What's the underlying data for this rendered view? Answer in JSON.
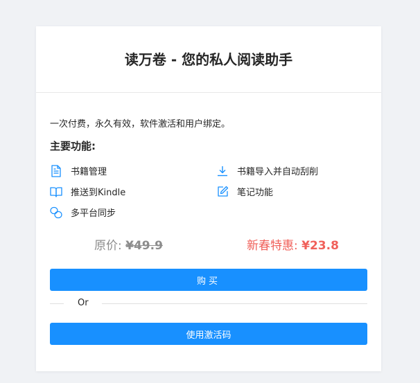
{
  "header": {
    "title": "读万卷 - 您的私人阅读助手"
  },
  "description": "一次付费，永久有效，软件激活和用户绑定。",
  "features": {
    "title": "主要功能:",
    "items": [
      {
        "label": "书籍管理",
        "icon": "document-icon"
      },
      {
        "label": "书籍导入并自动刮削",
        "icon": "download-icon"
      },
      {
        "label": "推送到Kindle",
        "icon": "book-icon"
      },
      {
        "label": "笔记功能",
        "icon": "edit-icon"
      },
      {
        "label": "多平台同步",
        "icon": "sync-icon"
      }
    ]
  },
  "pricing": {
    "original_label": "原价:",
    "original_price": "¥49.9",
    "sale_label": "新春特惠:",
    "sale_price": "¥23.8"
  },
  "buttons": {
    "buy": "购买",
    "divider": "Or",
    "activation_code": "使用激活码"
  },
  "colors": {
    "accent": "#1890ff",
    "sale": "#f0605a",
    "muted": "#8c8c8c",
    "icon": "#1890ff"
  }
}
